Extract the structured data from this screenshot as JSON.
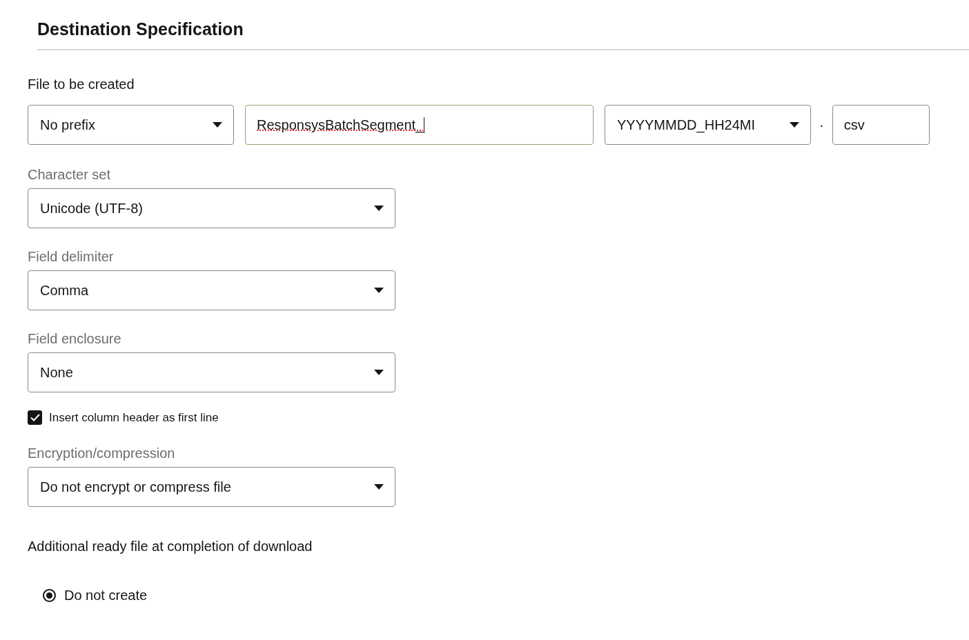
{
  "title": "Destination Specification",
  "file_name": {
    "label": "File to be created",
    "prefix": {
      "value": "No prefix"
    },
    "name": {
      "value": "ResponsysBatchSegment_",
      "focused": true
    },
    "date_format": {
      "value": "YYYYMMDD_HH24MI"
    },
    "separator": "·",
    "extension": {
      "value": "csv"
    }
  },
  "fields": [
    {
      "kind": "select",
      "label": "Character set",
      "value": "Unicode (UTF-8)"
    },
    {
      "kind": "select",
      "label": "Field delimiter",
      "value": "Comma"
    },
    {
      "kind": "select",
      "label": "Field enclosure",
      "value": "None"
    },
    {
      "kind": "checkbox",
      "label": "Insert column header as first line",
      "checked": true
    },
    {
      "kind": "select",
      "label": "Encryption/compression",
      "value": "Do not encrypt or compress file"
    }
  ],
  "ready_file": {
    "label": "Additional ready file at completion of download",
    "options": [
      {
        "label": "Do not create",
        "selected": true
      }
    ]
  }
}
